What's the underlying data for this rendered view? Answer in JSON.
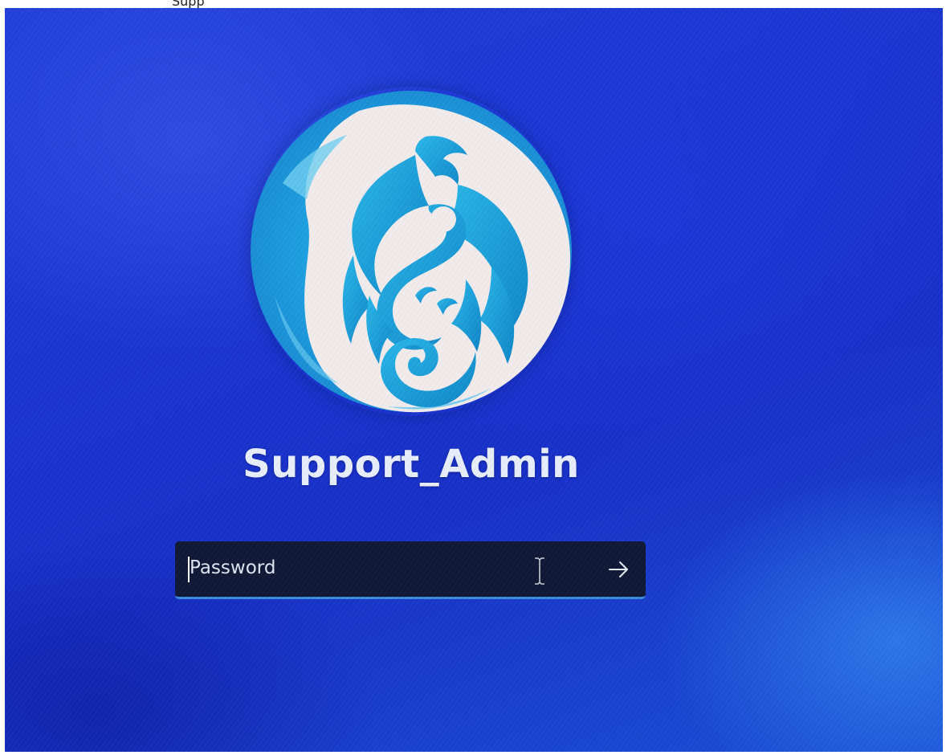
{
  "top_fragment": "_Supp",
  "lockscreen": {
    "username": "Support_Admin",
    "password": {
      "placeholder": "Password",
      "value": ""
    },
    "submit_icon": "arrow-right-icon",
    "avatar_icon": "phoenix-logo-icon"
  },
  "colors": {
    "background": "#1a35d2",
    "avatar_blue": "#1d9fe0",
    "avatar_light": "#f3ecec",
    "input_bg": "#0f1836",
    "input_accent": "#3a8de0",
    "text": "#e9eefc"
  }
}
